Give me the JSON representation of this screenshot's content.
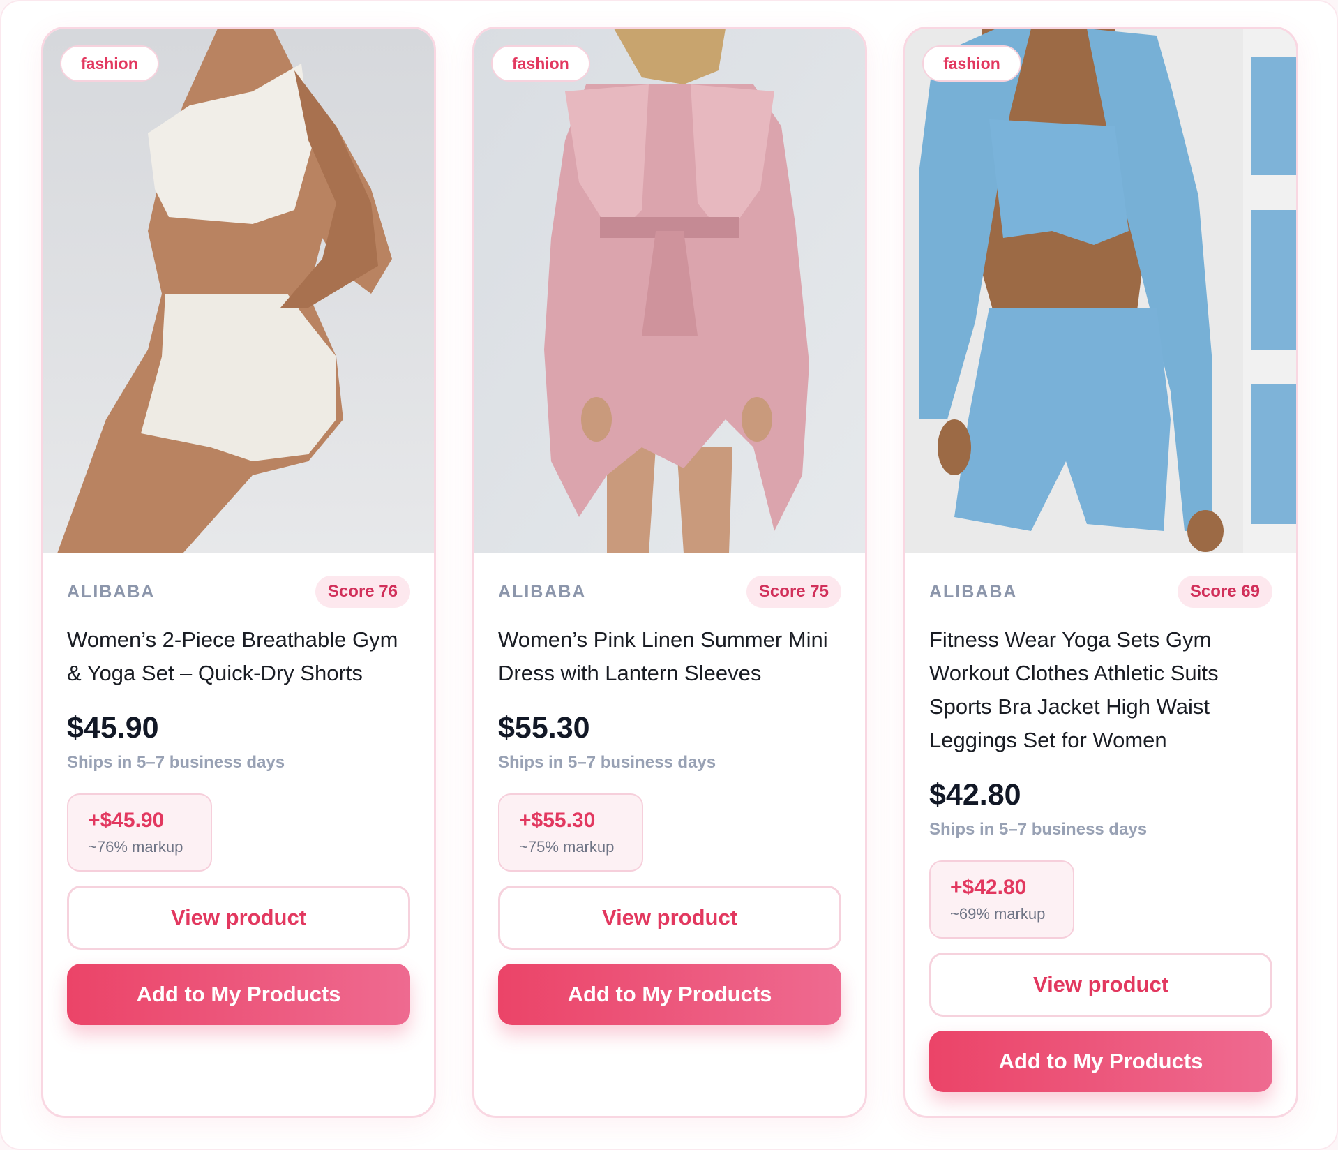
{
  "products": [
    {
      "category": "fashion",
      "supplier": "ALIBABA",
      "score": "Score 76",
      "title": "Women’s 2-Piece Breathable Gym & Yoga Set – Quick-Dry Shorts",
      "price": "$45.90",
      "shipping": "Ships in 5–7 business days",
      "profit": "+$45.90",
      "markup": "~76% markup",
      "view_label": "View product",
      "add_label": "Add to My Products",
      "image_desc": "white-activewear-set"
    },
    {
      "category": "fashion",
      "supplier": "ALIBABA",
      "score": "Score 75",
      "title": "Women’s Pink Linen Summer Mini Dress with Lantern Sleeves",
      "price": "$55.30",
      "shipping": "Ships in 5–7 business days",
      "profit": "+$55.30",
      "markup": "~75% markup",
      "view_label": "View product",
      "add_label": "Add to My Products",
      "image_desc": "pink-ruffle-dress"
    },
    {
      "category": "fashion",
      "supplier": "ALIBABA",
      "score": "Score 69",
      "title": "Fitness Wear Yoga Sets Gym Workout Clothes Athletic Suits Sports Bra Jacket High Waist Leggings Set for Women",
      "price": "$42.80",
      "shipping": "Ships in 5–7 business days",
      "profit": "+$42.80",
      "markup": "~69% markup",
      "view_label": "View product",
      "add_label": "Add to My Products",
      "image_desc": "blue-yoga-set"
    }
  ],
  "colors": {
    "accent": "#e2385f",
    "button_gradient_start": "#eb4468",
    "button_gradient_end": "#ee6a90",
    "card_border": "#f9d7e2"
  }
}
